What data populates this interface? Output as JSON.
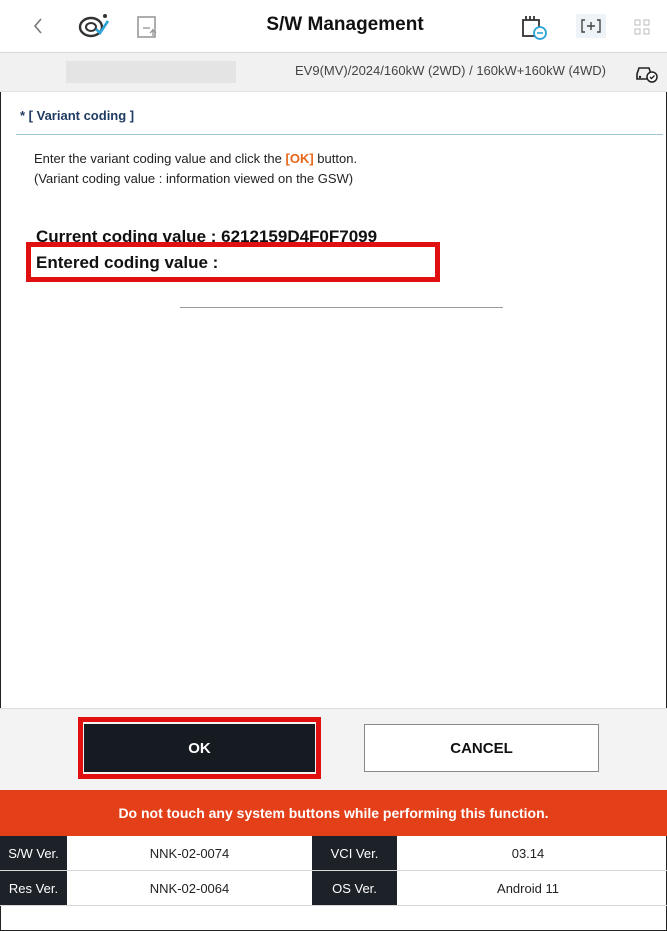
{
  "header": {
    "title": "S/W Management",
    "back_icon": "chevron-left-icon",
    "left_icons": [
      "diagnosis-car-icon",
      "document-upload-icon"
    ],
    "right_icons": [
      "vci-connection-icon",
      "expand-icon",
      "grid-menu-icon"
    ]
  },
  "vehicle": {
    "info": "EV9(MV)/2024/160kW (2WD) / 160kW+160kW (4WD)",
    "icon": "vehicle-check-icon"
  },
  "section": {
    "title": "* [ Variant coding ]",
    "instruction_line1_pre": "Enter the variant coding value and click the",
    "instruction_ok": "[OK]",
    "instruction_line1_post": "button.",
    "instruction_line2": "(Variant coding value : information viewed on the GSW)"
  },
  "coding": {
    "current_label": "Current coding value : 6212159D4F0F7099",
    "entered_label": "Entered coding value :"
  },
  "buttons": {
    "ok_label": "OK",
    "cancel_label": "CANCEL"
  },
  "warning": "Do not touch any system buttons while performing this function.",
  "versions": {
    "rows": [
      {
        "label1": "S/W Ver.",
        "value1": "NNK-02-0074",
        "label2": "VCI Ver.",
        "value2": "03.14"
      },
      {
        "label1": "Res Ver.",
        "value1": "NNK-02-0064",
        "label2": "OS Ver.",
        "value2": "Android 11"
      }
    ]
  },
  "colors": {
    "highlight": "#e01010",
    "warning_bg": "#e3401a",
    "ok_bg": "#161b22",
    "accent": "#e8651a"
  }
}
